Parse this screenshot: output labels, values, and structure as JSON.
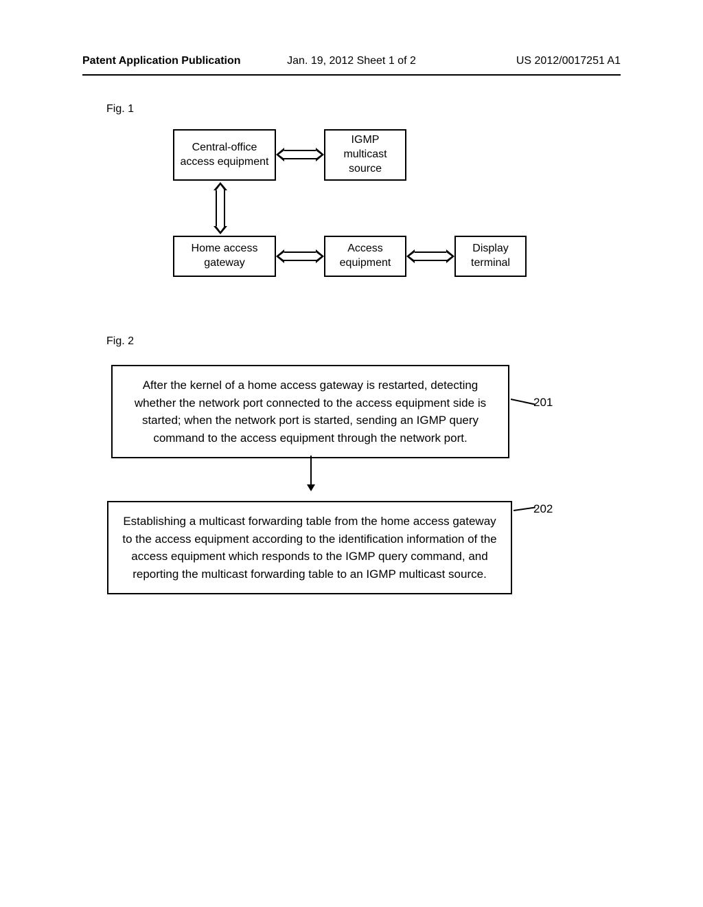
{
  "header": {
    "left": "Patent Application Publication",
    "center": "Jan. 19, 2012  Sheet 1 of 2",
    "right": "US 2012/0017251 A1"
  },
  "fig1": {
    "label": "Fig. 1",
    "boxes": {
      "central": "Central-office access equipment",
      "igmp": "IGMP multicast source",
      "home": "Home access gateway",
      "access": "Access equipment",
      "display": "Display terminal"
    }
  },
  "fig2": {
    "label": "Fig. 2",
    "step1": "After the kernel of a home access gateway is restarted, detecting whether the network port connected to the access equipment side is started;  when the network port is started, sending an IGMP query command to the access equipment through the network port.",
    "step2": "Establishing a multicast forwarding table from the home access gateway to the access equipment according to the identification information of the access equipment which responds to the IGMP query command, and reporting the multicast forwarding table to an IGMP multicast source.",
    "ref1": "201",
    "ref2": "202"
  }
}
